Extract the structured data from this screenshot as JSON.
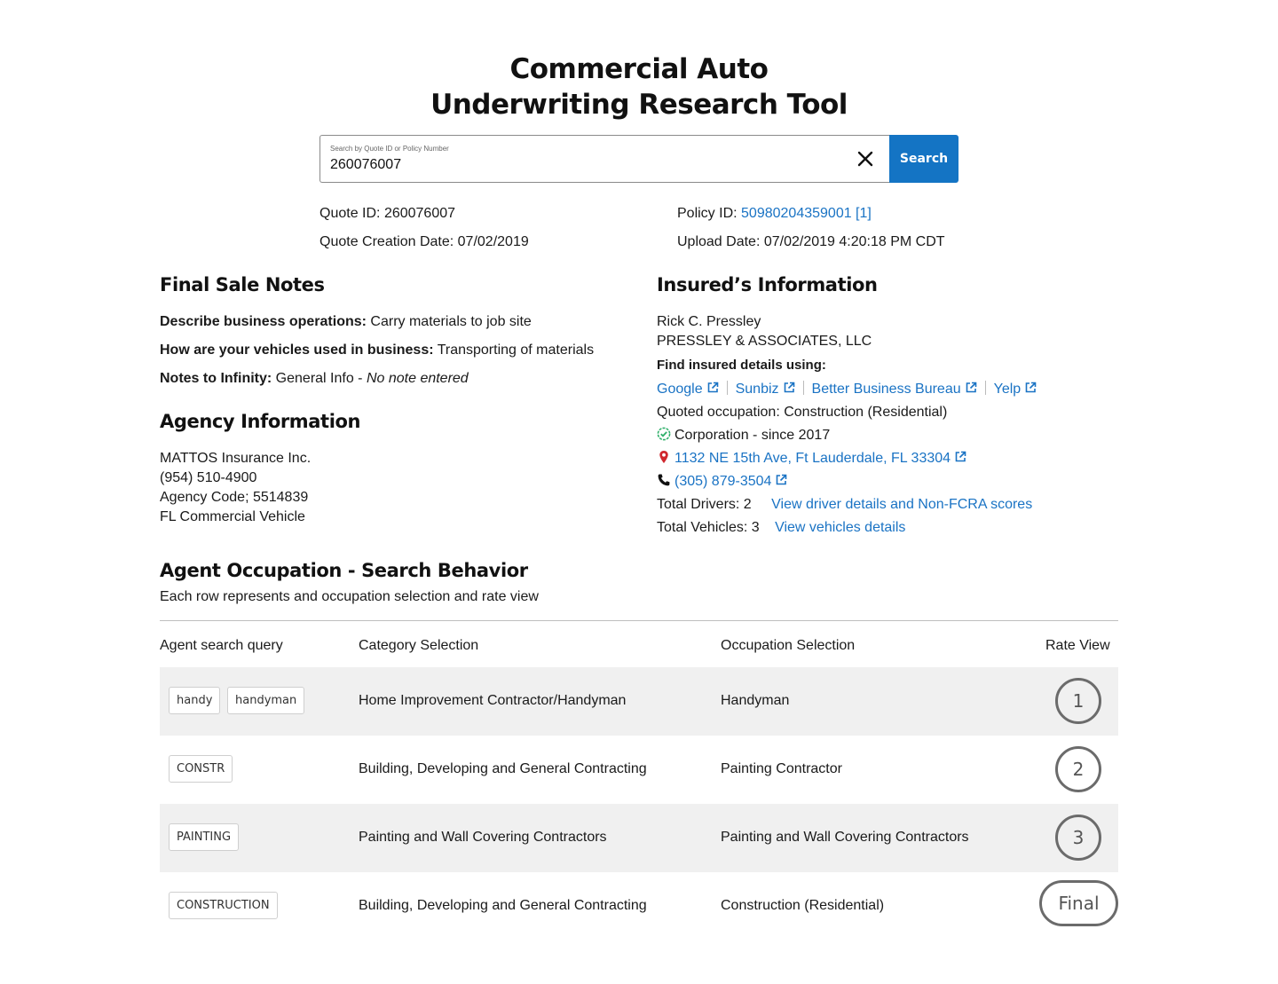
{
  "page": {
    "title_line1": "Commercial Auto",
    "title_line2": "Underwriting Research Tool"
  },
  "search": {
    "label": "Search by Quote ID or Policy Number",
    "value": "260076007",
    "button": "Search"
  },
  "quote": {
    "quote_id_label": "Quote ID:",
    "quote_id": "260076007",
    "creation_label": "Quote Creation Date:",
    "creation_date": "07/02/2019",
    "policy_id_label": "Policy ID:",
    "policy_id": "50980204359001 [1]",
    "upload_label": "Upload Date:",
    "upload_date": "07/02/2019 4:20:18 PM CDT"
  },
  "final_sale": {
    "heading": "Final Sale Notes",
    "q1_label": "Describe business operations:",
    "q1_value": "Carry materials to job site",
    "q2_label": "How are your vehicles used in business:",
    "q2_value": "Transporting of materials",
    "q3_label": "Notes to Infinity:",
    "q3_value": "General Info - ",
    "q3_note": "No note entered"
  },
  "agency": {
    "heading": "Agency Information",
    "name": "MATTOS Insurance Inc.",
    "phone": "(954) 510-4900",
    "code": "Agency Code; 5514839",
    "product": "FL Commercial Vehicle"
  },
  "insured": {
    "heading": "Insured’s Information",
    "person": "Rick C. Pressley",
    "company": "PRESSLEY & ASSOCIATES, LLC",
    "find_label": "Find insured details using:",
    "links": [
      "Google",
      "Sunbiz",
      "Better Business Bureau",
      "Yelp"
    ],
    "occupation": "Quoted occupation: Construction (Residential)",
    "entity": "Corporation - since 2017",
    "address": "1132 NE 15th Ave, Ft Lauderdale, FL 33304",
    "phone": "(305) 879-3504",
    "drivers_label": "Total Drivers: 2",
    "drivers_link": "View driver details and Non-FCRA scores",
    "vehicles_label": "Total Vehicles: 3",
    "vehicles_link": "View vehicles details",
    "colors": {
      "verified": "#2fb06a",
      "pin": "#d0272d",
      "link": "#1a73c4"
    }
  },
  "behavior": {
    "heading": "Agent Occupation - Search Behavior",
    "subtitle": "Each row represents and occupation selection and rate view",
    "columns": [
      "Agent search query",
      "Category Selection",
      "Occupation Selection",
      "Rate View"
    ],
    "rows": [
      {
        "queries": [
          "handy",
          "handyman"
        ],
        "category": "Home Improvement Contractor/Handyman",
        "occupation": "Handyman",
        "rate": "1"
      },
      {
        "queries": [
          "CONSTR"
        ],
        "category": "Building, Developing and General Contracting",
        "occupation": "Painting Contractor",
        "rate": "2"
      },
      {
        "queries": [
          "PAINTING"
        ],
        "category": "Painting and Wall Covering Contractors",
        "occupation": "Painting and Wall Covering Contractors",
        "rate": "3"
      },
      {
        "queries": [
          "CONSTRUCTION"
        ],
        "category": "Building, Developing and General Contracting",
        "occupation": "Construction (Residential)",
        "rate": "Final"
      }
    ]
  }
}
